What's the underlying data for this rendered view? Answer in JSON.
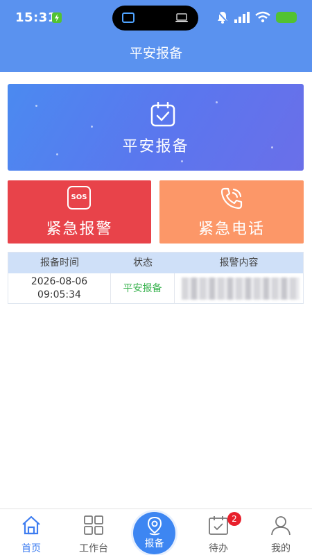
{
  "status_bar": {
    "time": "15:31",
    "icons": [
      "charging-bolt-icon",
      "screen-mirror-icon",
      "laptop-icon",
      "bell-icon",
      "signal-icon",
      "wifi-icon",
      "battery-icon"
    ]
  },
  "header": {
    "title": "平安报备"
  },
  "banner": {
    "label": "平安报备",
    "icon": "calendar-check-icon",
    "colors": [
      "#4b8af0",
      "#6a6fe9"
    ]
  },
  "actions": [
    {
      "label": "紧急报警",
      "icon": "sos-icon",
      "color": "#e8434a",
      "icon_text": "SOS"
    },
    {
      "label": "紧急电话",
      "icon": "phone-call-icon",
      "color": "#fc9768"
    }
  ],
  "table": {
    "headers": [
      "报备时间",
      "状态",
      "报警内容"
    ],
    "rows": [
      {
        "date": "2026-08-06",
        "time": "09:05:34",
        "status": "平安报备"
      }
    ]
  },
  "tabbar": {
    "tabs": [
      {
        "label": "首页",
        "icon": "home-icon",
        "active": true
      },
      {
        "label": "工作台",
        "icon": "grid-icon",
        "active": false
      },
      {
        "label": "报备",
        "icon": "location-pin-icon",
        "active": false
      },
      {
        "label": "待办",
        "icon": "todo-check-icon",
        "active": false,
        "badge": "2"
      },
      {
        "label": "我的",
        "icon": "user-icon",
        "active": false
      }
    ]
  },
  "colors": {
    "header": "#5a92ef",
    "accent": "#3d86f2",
    "status_ok": "#37b24d",
    "badge": "#e8202c"
  }
}
